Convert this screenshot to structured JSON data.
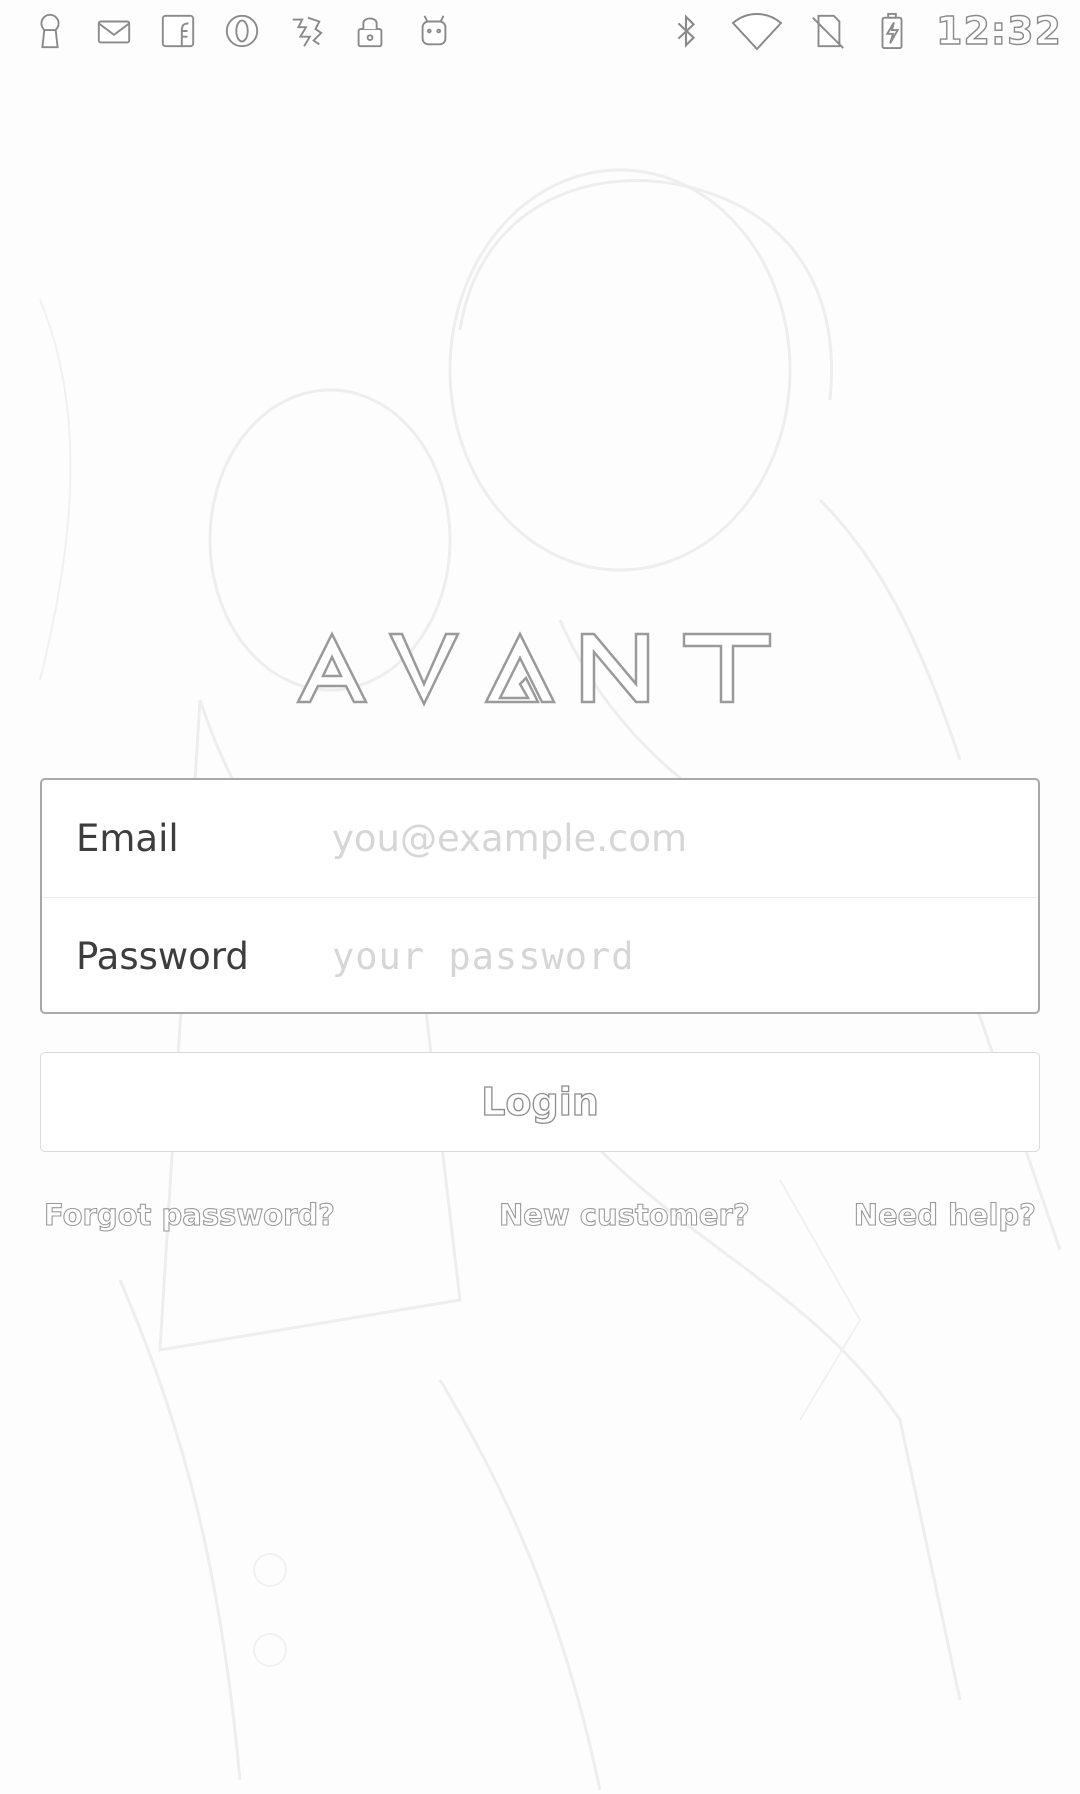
{
  "status_bar": {
    "left_icons": [
      "keyhole-icon",
      "mail-icon",
      "facebook-icon",
      "opera-icon",
      "games-icon",
      "lock-icon",
      "android-icon"
    ],
    "right_icons": [
      "bluetooth-icon",
      "wifi-icon",
      "no-sim-icon",
      "battery-charging-icon"
    ],
    "time": "12:32"
  },
  "app": {
    "logo_text": "AVANT"
  },
  "form": {
    "email_label": "Email",
    "email_placeholder": "you@example.com",
    "email_value": "",
    "password_label": "Password",
    "password_placeholder": "your password",
    "password_value": ""
  },
  "actions": {
    "login_label": "Login",
    "forgot_password": "Forgot password?",
    "new_customer": "New customer?",
    "need_help": "Need help?"
  }
}
